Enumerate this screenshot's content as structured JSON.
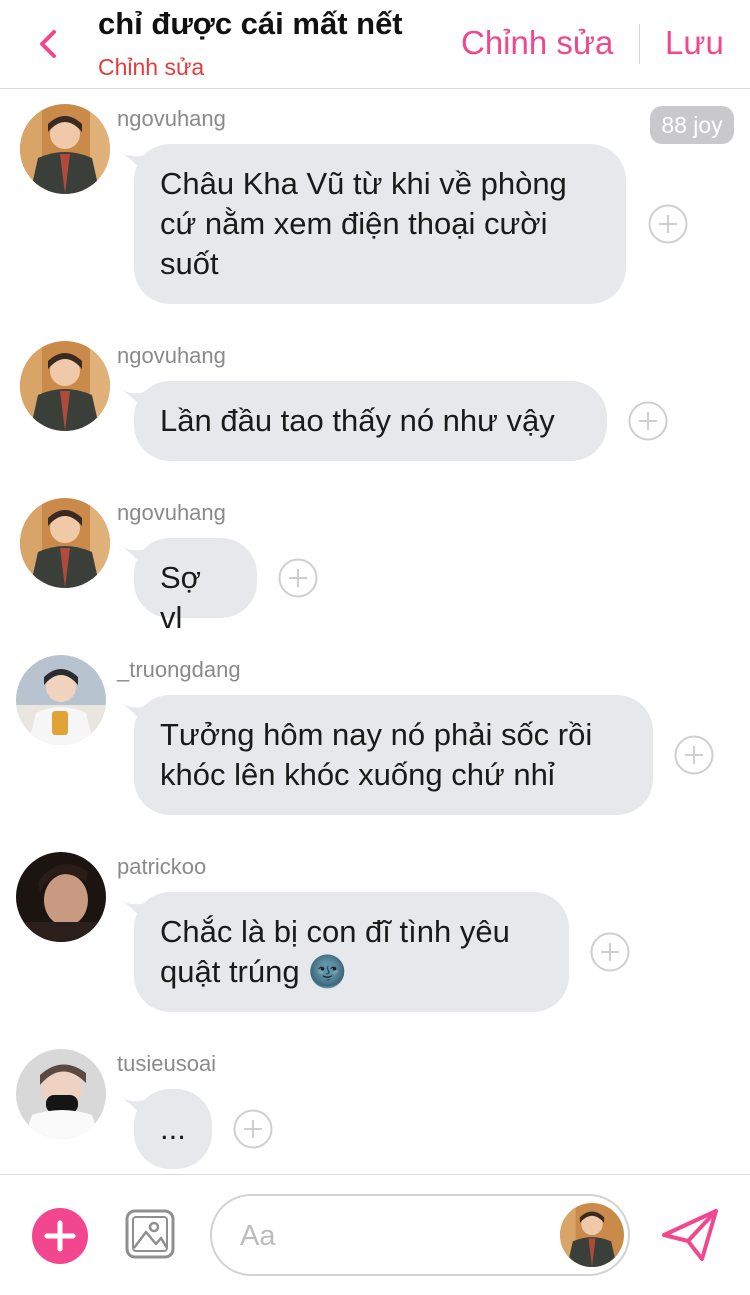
{
  "header": {
    "title": "chỉ được cái mất nết",
    "subtitle": "Chỉnh sửa",
    "edit_label": "Chỉnh sửa",
    "save_label": "Lưu"
  },
  "joy_badge": "88 joy",
  "messages": [
    {
      "username": "ngovuhang",
      "lines": [
        "Châu Kha Vũ từ khi về phòng",
        "cứ nằm xem điện thoại cười",
        "suốt"
      ]
    },
    {
      "username": "ngovuhang",
      "lines": [
        "Lần đầu tao thấy nó như vậy"
      ]
    },
    {
      "username": "ngovuhang",
      "lines": [
        "Sợ vl"
      ]
    },
    {
      "username": "_truongdang",
      "lines": [
        "Tưởng hôm nay nó phải sốc rồi",
        "khóc lên khóc xuống chứ nhỉ"
      ]
    },
    {
      "username": "patrickoo",
      "lines": [
        "Chắc là bị con đĩ tình yêu",
        "quật trúng 🌚"
      ]
    },
    {
      "username": "tusieusoai",
      "lines": [
        "..."
      ]
    }
  ],
  "composer": {
    "placeholder": "Aa"
  },
  "colors": {
    "accent": "#f2478e",
    "subtitle": "#e63b3b",
    "bubble": "#e6e8eb",
    "username": "#8a8a8a"
  }
}
